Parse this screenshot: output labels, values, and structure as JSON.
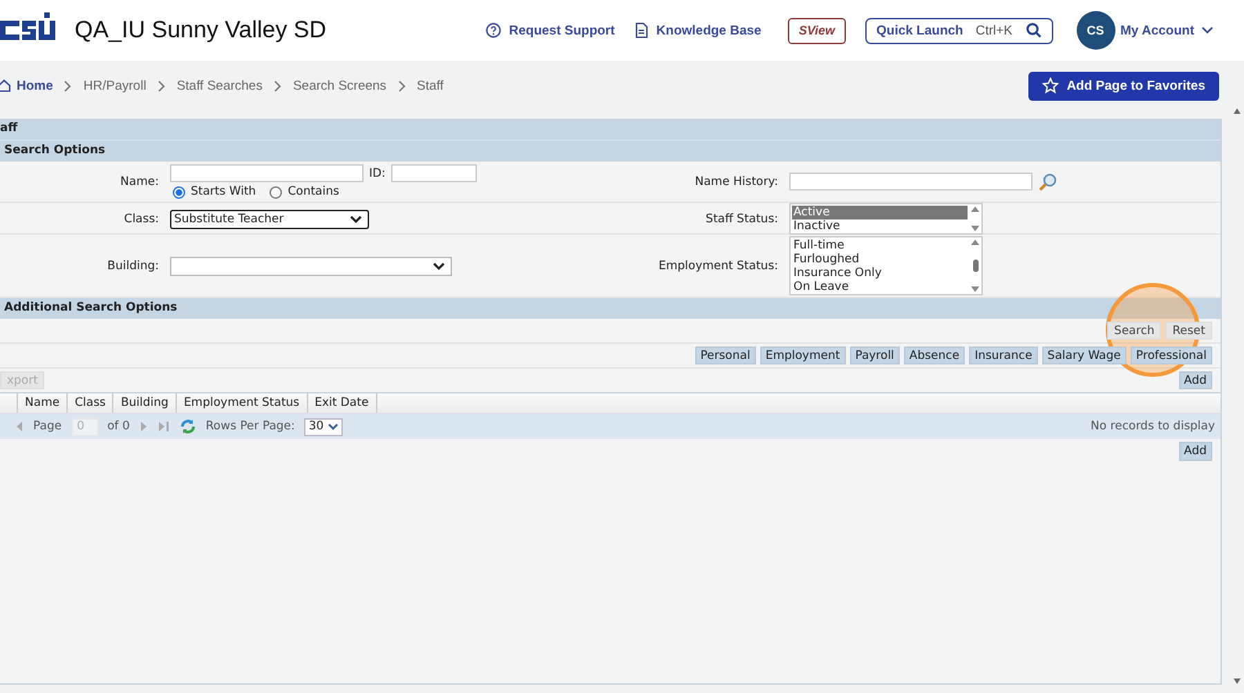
{
  "header": {
    "org_title": "QA_IU Sunny Valley SD",
    "links": [
      {
        "kind": "support",
        "label": "Request Support"
      },
      {
        "kind": "doc",
        "label": "Knowledge Base"
      }
    ],
    "sview_label": "SView",
    "quick_launch": {
      "label": "Quick Launch",
      "shortcut": "Ctrl+K"
    },
    "account": {
      "initials": "CS",
      "label": "My Account"
    }
  },
  "breadcrumb": [
    "Home",
    "HR/Payroll",
    "Staff Searches",
    "Search Screens",
    "Staff"
  ],
  "favorites_button": "Add Page to Favorites",
  "panel": {
    "title": "aff",
    "search_options_title": "Search Options",
    "name": {
      "label": "Name:"
    },
    "id": {
      "label": "ID:"
    },
    "match_options": [
      {
        "label": "Starts With",
        "selected": true
      },
      {
        "label": "Contains",
        "selected": false
      }
    ],
    "name_history": {
      "label": "Name History:"
    },
    "class": {
      "label": "Class:",
      "value": "Substitute Teacher"
    },
    "staff_status": {
      "label": "Staff Status:",
      "options": [
        {
          "label": "Active",
          "selected": true
        },
        {
          "label": "Inactive",
          "selected": false
        }
      ]
    },
    "building": {
      "label": "Building:"
    },
    "employment_status": {
      "label": "Employment Status:",
      "options": [
        {
          "label": "Full-time",
          "selected": false
        },
        {
          "label": "Furloughed",
          "selected": false
        },
        {
          "label": "Insurance Only",
          "selected": false
        },
        {
          "label": "On Leave",
          "selected": false
        }
      ]
    },
    "additional_options_title": "Additional Search Options",
    "action_buttons": [
      "Search",
      "Reset"
    ],
    "view_buttons": [
      "Personal",
      "Employment",
      "Payroll",
      "Absence",
      "Insurance",
      "Salary Wage",
      "Professional"
    ],
    "export_button": {
      "label": "xport",
      "disabled": true
    },
    "add_button_top": "Add",
    "grid_columns": [
      "Name",
      "Class",
      "Building",
      "Employment Status",
      "Exit Date"
    ],
    "pager": {
      "page_label": "Page",
      "page_value": "0",
      "of_label": "of 0",
      "rows_label": "Rows Per Page:",
      "rows_value": "30",
      "empty_message": "No records to display"
    },
    "add_button_bottom": "Add"
  }
}
